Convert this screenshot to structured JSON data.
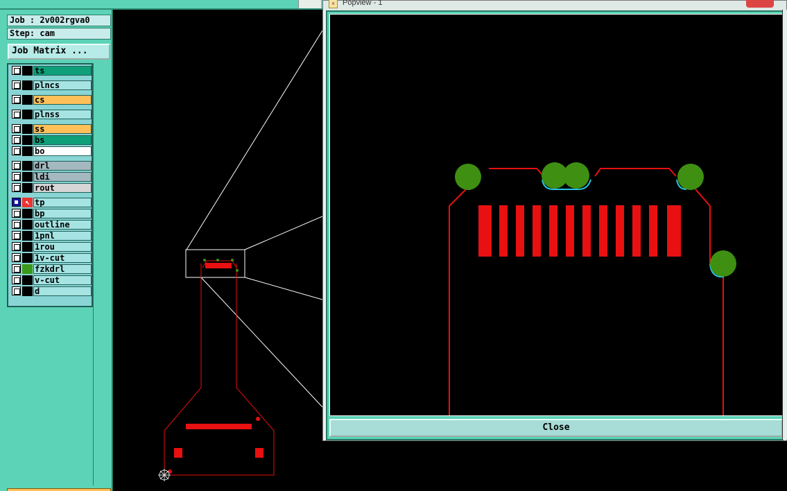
{
  "job": {
    "label": "Job : 2v002rgva0",
    "step": "Step: cam",
    "matrix_button": "Job Matrix ..."
  },
  "layers": [
    {
      "name": "ts",
      "color": "#0fa07a"
    },
    {
      "name": "plncs",
      "color": "#a6e3e3"
    },
    {
      "name": "cs",
      "color": "#ffc05a"
    },
    {
      "name": "plnss",
      "color": "#a6e3e3"
    },
    {
      "name": "ss",
      "color": "#ffc05a"
    },
    {
      "name": "bs",
      "color": "#0fa07a"
    },
    {
      "name": "bo",
      "color": "#ffffff"
    },
    {
      "name": "drl",
      "color": "#a4b8bf"
    },
    {
      "name": "ldi",
      "color": "#a4b8bf"
    },
    {
      "name": "rout",
      "color": "#d6d6d6"
    },
    {
      "name": "tp",
      "color": "#a6e3e3"
    },
    {
      "name": "bp",
      "color": "#a6e3e3"
    },
    {
      "name": "outline",
      "color": "#a6e3e3"
    },
    {
      "name": "1pnl",
      "color": "#a6e3e3"
    },
    {
      "name": "1rou",
      "color": "#a6e3e3"
    },
    {
      "name": "1v-cut",
      "color": "#a6e3e3"
    },
    {
      "name": "fzkdrl",
      "color": "#a6e3e3",
      "swatch": "#3c9a1a"
    },
    {
      "name": "v-cut",
      "color": "#a6e3e3"
    },
    {
      "name": "d",
      "color": "#a6e3e3"
    }
  ],
  "popup": {
    "title": "Popview - 1",
    "close_label": "Close"
  },
  "colors": {
    "trace": "#e81010",
    "pad": "#3f8f12",
    "outline": "#ffffff",
    "panel": "#5cd3b6"
  },
  "icons": {
    "window": "popview-window-icon",
    "close": "close-icon",
    "origin": "origin-crosshair-icon"
  }
}
